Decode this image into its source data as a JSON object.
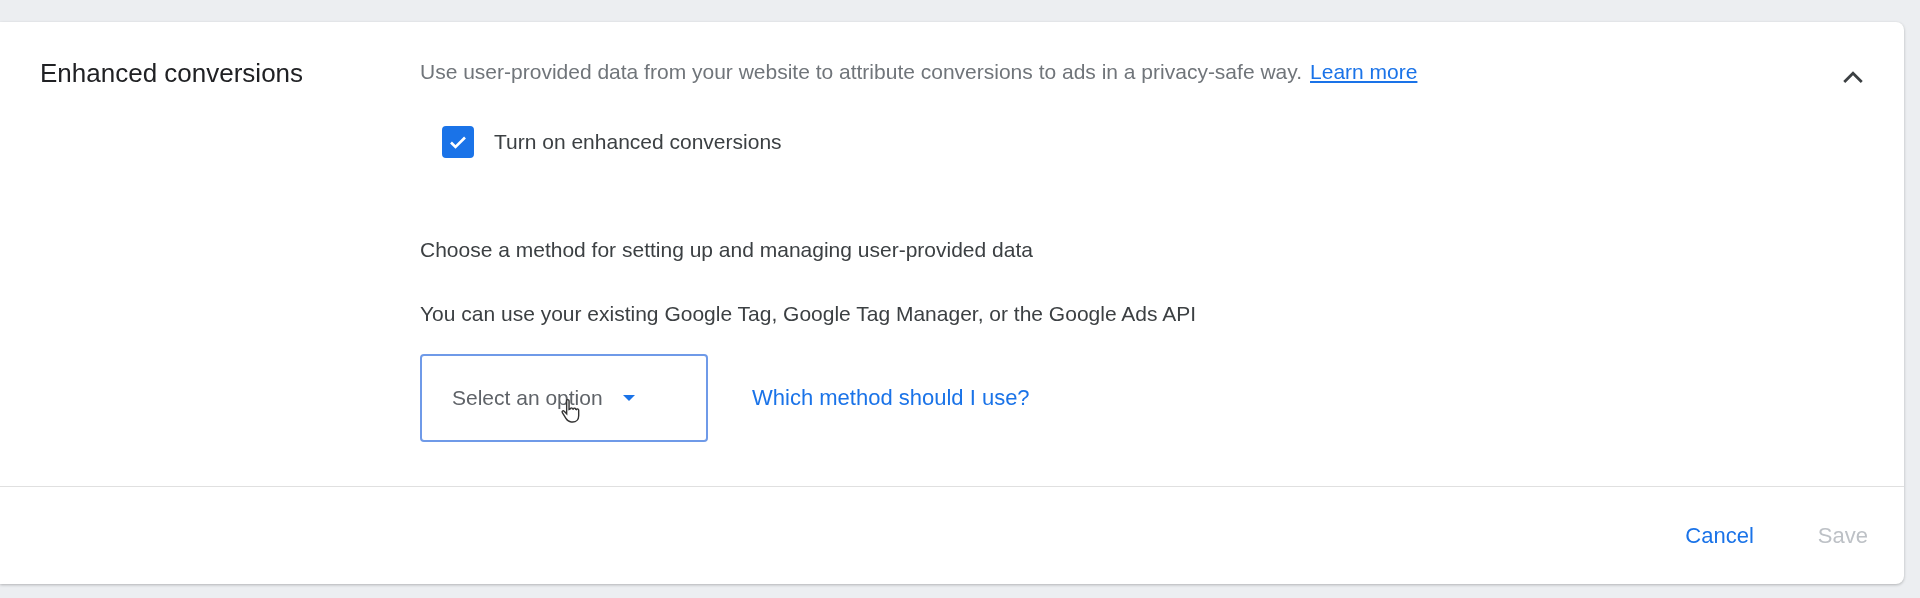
{
  "section": {
    "title": "Enhanced conversions",
    "expanded": true,
    "description": "Use user-provided data from your website to attribute conversions to ads in a privacy-safe way.",
    "learn_more": "Learn more"
  },
  "checkbox": {
    "label": "Turn on enhanced conversions",
    "checked": true
  },
  "method_heading": "Choose a method for setting up and managing user-provided data",
  "method_hint": "You can use your existing Google Tag, Google Tag Manager, or the Google Ads API",
  "select": {
    "placeholder": "Select an option"
  },
  "help_link": "Which method should I use?",
  "buttons": [
    {
      "label": "Cancel",
      "disabled": false
    },
    {
      "label": "Save",
      "disabled": true
    }
  ]
}
